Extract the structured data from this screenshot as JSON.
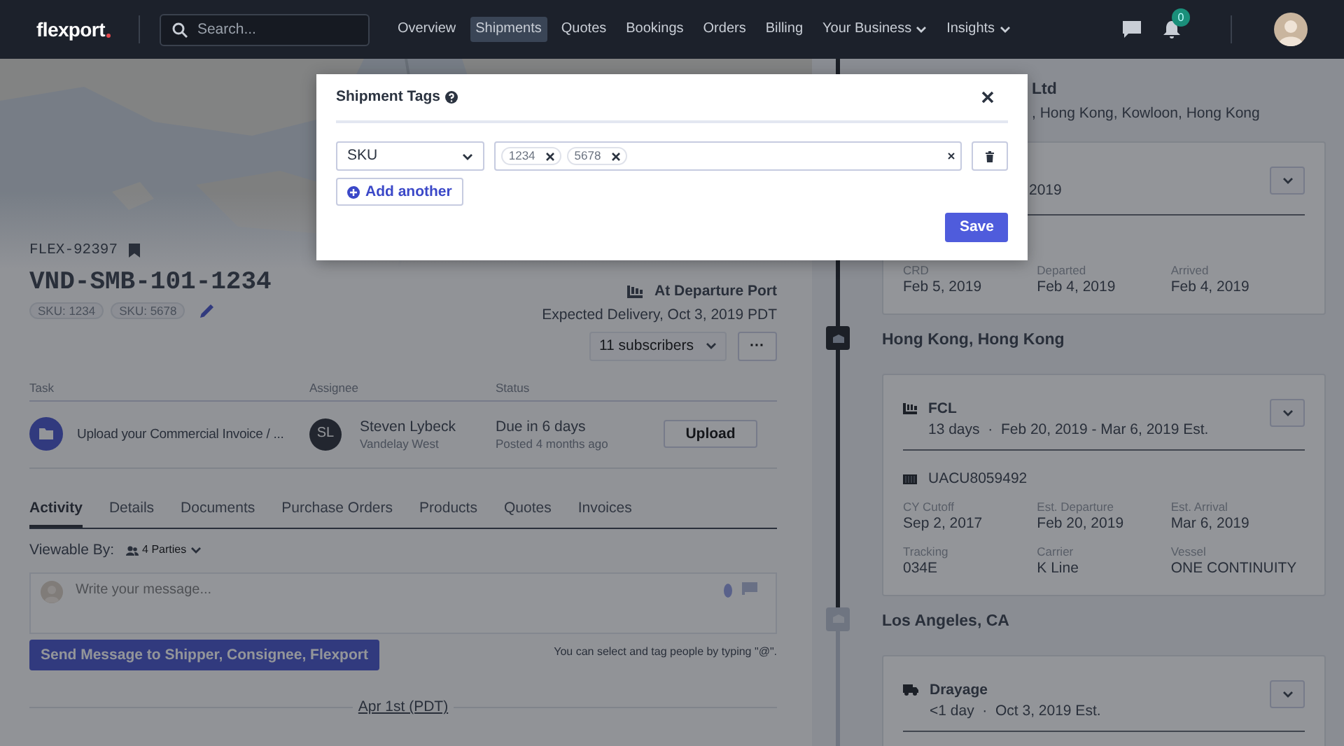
{
  "nav": {
    "logo": "flexport",
    "search_placeholder": "Search...",
    "links": [
      {
        "label": "Overview",
        "selected": false,
        "dropdown": false
      },
      {
        "label": "Shipments",
        "selected": true,
        "dropdown": false
      },
      {
        "label": "Quotes",
        "selected": false,
        "dropdown": false
      },
      {
        "label": "Bookings",
        "selected": false,
        "dropdown": false
      },
      {
        "label": "Orders",
        "selected": false,
        "dropdown": false
      },
      {
        "label": "Billing",
        "selected": false,
        "dropdown": false
      },
      {
        "label": "Your Business",
        "selected": false,
        "dropdown": true
      },
      {
        "label": "Insights",
        "selected": false,
        "dropdown": true
      }
    ],
    "notification_count": "0"
  },
  "shipment": {
    "id": "FLEX-92397",
    "title": "VND-SMB-101-1234",
    "tags": [
      "SKU: 1234",
      "SKU: 5678"
    ],
    "status": "At Departure Port",
    "expected": "Expected Delivery, Oct 3, 2019 PDT",
    "subscribers": "11 subscribers",
    "more": "···"
  },
  "tasks": {
    "columns": [
      "Task",
      "Assignee",
      "Status"
    ],
    "rows": [
      {
        "task": "Upload your Commercial Invoice / ...",
        "initials": "SL",
        "assignee": "Steven Lybeck",
        "company": "Vandelay West",
        "status": "Due in 6 days",
        "posted": "Posted 4 months ago",
        "action": "Upload"
      }
    ]
  },
  "tabs": [
    {
      "label": "Activity",
      "selected": true
    },
    {
      "label": "Details",
      "selected": false
    },
    {
      "label": "Documents",
      "selected": false
    },
    {
      "label": "Purchase Orders",
      "selected": false
    },
    {
      "label": "Products",
      "selected": false
    },
    {
      "label": "Quotes",
      "selected": false
    },
    {
      "label": "Invoices",
      "selected": false
    }
  ],
  "activity": {
    "viewable_label": "Viewable By:",
    "parties": "4 Parties",
    "placeholder": "Write your message...",
    "send": "Send Message to Shipper, Consignee, Flexport",
    "hint": "You can select and tag people by typing \"@\".",
    "date": "Apr 1st (PDT)"
  },
  "timeline": [
    {
      "kind": "place",
      "name": "Ltd",
      "address": ", Hong Kong, Kowloon, Hong Kong"
    },
    {
      "kind": "leg",
      "summary": "2019",
      "fields": [
        {
          "label": "CRD",
          "value": "Feb 5, 2019"
        },
        {
          "label": "Departed",
          "value": "Feb 4, 2019"
        },
        {
          "label": "Arrived",
          "value": "Feb 4, 2019"
        }
      ]
    },
    {
      "kind": "place",
      "name": "Hong Kong, Hong Kong",
      "reached": true
    },
    {
      "kind": "ocean",
      "title": "FCL",
      "summary": "13 days  ·  Feb 20, 2019 - Mar 6, 2019 Est.",
      "container": "UACU8059492",
      "fields": [
        {
          "label": "CY Cutoff",
          "value": "Sep 2, 2017"
        },
        {
          "label": "Est. Departure",
          "value": "Feb 20, 2019"
        },
        {
          "label": "Est. Arrival",
          "value": "Mar 6, 2019"
        },
        {
          "label": "Tracking",
          "value": "034E"
        },
        {
          "label": "Carrier",
          "value": "K Line"
        },
        {
          "label": "Vessel",
          "value": "ONE CONTINUITY"
        }
      ]
    },
    {
      "kind": "place",
      "name": "Los Angeles, CA",
      "reached": false
    },
    {
      "kind": "truck",
      "title": "Drayage",
      "summary": "<1 day  ·  Oct 3, 2019 Est."
    }
  ],
  "modal": {
    "title": "Shipment Tags",
    "field": "SKU",
    "values": [
      "1234",
      "5678"
    ],
    "add": "Add another",
    "save": "Save"
  }
}
